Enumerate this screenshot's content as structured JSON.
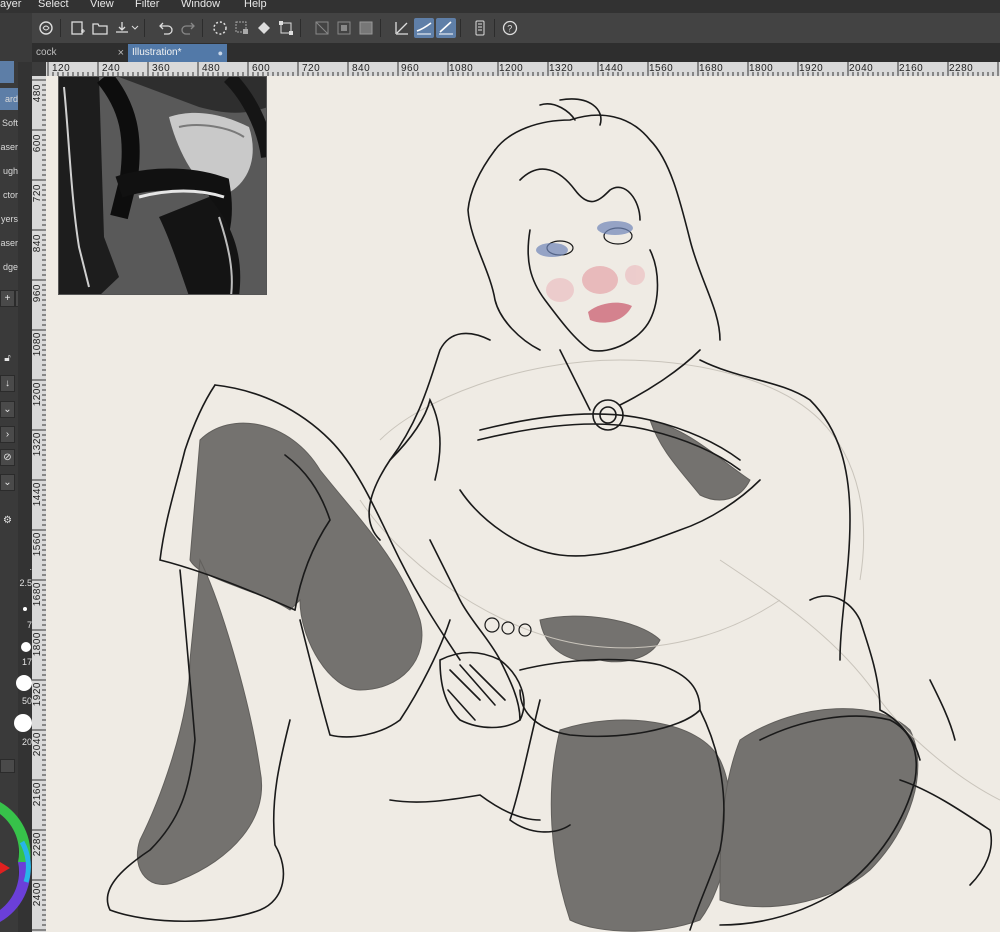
{
  "menu": [
    "ayer",
    "Select",
    "View",
    "Filter",
    "Window",
    "Help"
  ],
  "tabs": [
    {
      "label": "cock",
      "close": "×"
    },
    {
      "label": "Illustration*",
      "close": "●"
    }
  ],
  "toolbar_icons": [
    "sub-view-icon",
    "new-icon",
    "open-icon",
    "save-icon",
    "undo-icon",
    "redo-icon",
    "loading-icon",
    "selection-icon",
    "fill-icon",
    "transform-icon",
    "hide-selection-icon",
    "clear-icon",
    "fill-selection-icon",
    "stabilizer-icon",
    "snap-ruler-icon",
    "snap-grid-icon",
    "smartphone-icon",
    "help-icon"
  ],
  "subtool_items": [
    "ard",
    "Soft",
    "aser",
    "ugh",
    "ctor",
    "yers",
    "aser",
    "dge"
  ],
  "brush_sizes": [
    ".",
    "2.5",
    "7",
    "17",
    "50",
    "20"
  ],
  "hruler_labels": [
    "120",
    "240",
    "360",
    "480",
    "600",
    "720",
    "840",
    "960",
    "1080",
    "1200",
    "1320",
    "1440",
    "1560",
    "1680",
    "1800",
    "1920",
    "2040",
    "2160",
    "2280"
  ],
  "vruler_labels": [
    "480",
    "600",
    "720",
    "840",
    "960",
    "1080",
    "1200",
    "1320",
    "1440",
    "1560",
    "1680",
    "1800",
    "1920",
    "2040",
    "2160",
    "2280",
    "2400"
  ],
  "colors": {
    "canvas": "#efebe4",
    "accent": "#5279a8",
    "sketch": "#1a1a1a",
    "shadow": "#6e6c69"
  }
}
